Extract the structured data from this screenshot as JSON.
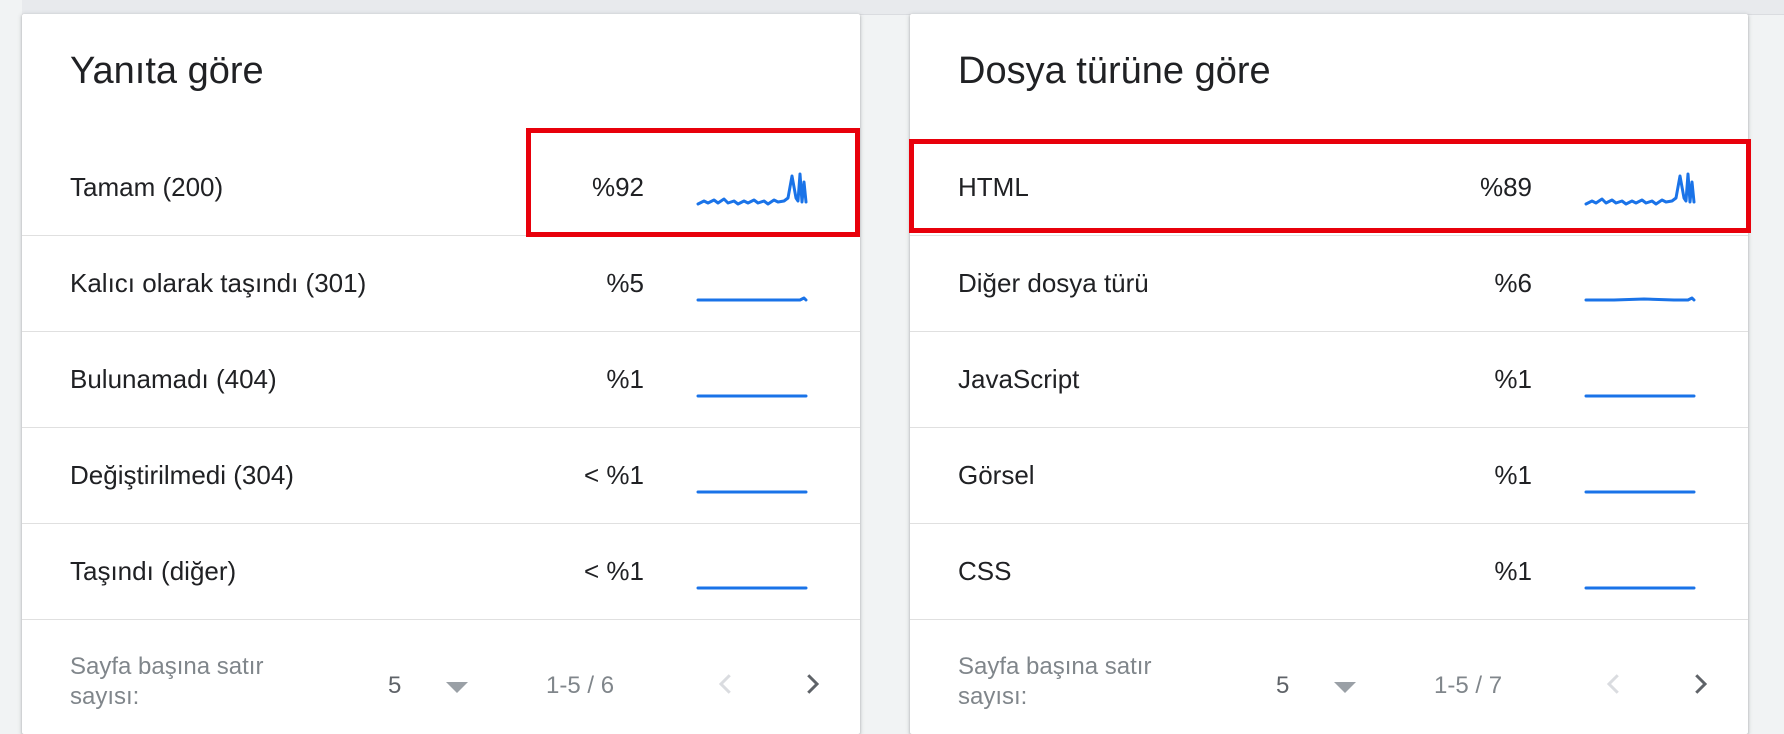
{
  "colors": {
    "accent": "#1a73e8",
    "highlight": "#e8000b",
    "muted": "#80868b"
  },
  "icons": {
    "prev": "chevron-left-icon",
    "next": "chevron-right-icon",
    "dropdown": "caret-down-icon"
  },
  "cards": [
    {
      "title": "Yanıta göre",
      "rows": [
        {
          "label": "Tamam (200)",
          "value": "%92"
        },
        {
          "label": "Kalıcı olarak taşındı (301)",
          "value": "%5"
        },
        {
          "label": "Bulunamadı (404)",
          "value": "%1"
        },
        {
          "label": "Değiştirilmedi (304)",
          "value": "< %1"
        },
        {
          "label": "Taşındı (diğer)",
          "value": "< %1"
        }
      ],
      "footer": {
        "rows_per_page_label": "Sayfa başına satır sayısı:",
        "rows_per_page": "5",
        "range": "1-5 / 6"
      }
    },
    {
      "title": "Dosya türüne göre",
      "rows": [
        {
          "label": "HTML",
          "value": "%89"
        },
        {
          "label": "Diğer dosya türü",
          "value": "%6"
        },
        {
          "label": "JavaScript",
          "value": "%1"
        },
        {
          "label": "Görsel",
          "value": "%1"
        },
        {
          "label": "CSS",
          "value": "%1"
        }
      ],
      "footer": {
        "rows_per_page_label": "Sayfa başına satır sayısı:",
        "rows_per_page": "5",
        "range": "1-5 / 7"
      }
    }
  ]
}
